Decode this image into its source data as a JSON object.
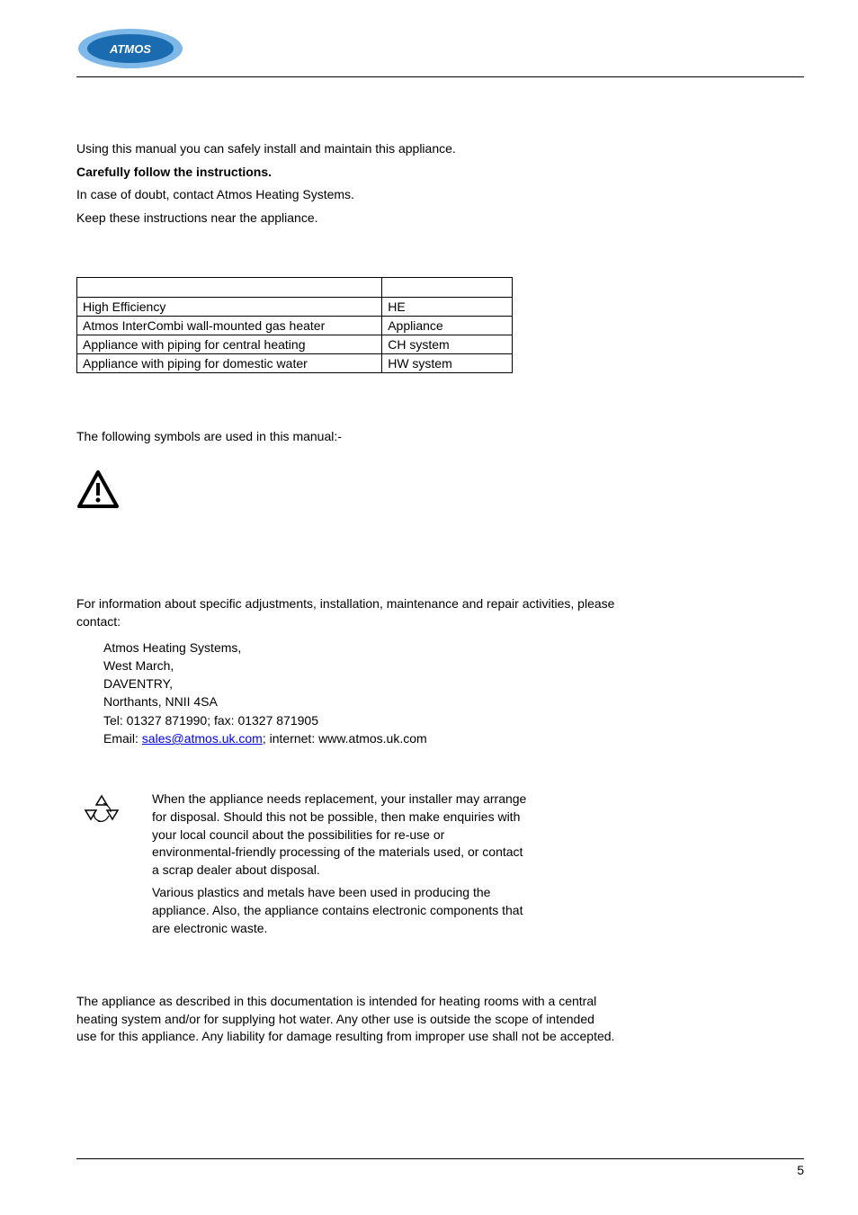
{
  "logo": {
    "text": "ATMOS"
  },
  "intro": {
    "line1a": "Using this manual you can safely install and maintain this appliance.",
    "line1b": "Carefully follow the instructions.",
    "line2": "In case of doubt, contact Atmos Heating Systems.",
    "line3": "Keep these instructions near the appliance."
  },
  "abbrev_table": {
    "rows": [
      {
        "term": "High Efficiency",
        "abbrev": "HE"
      },
      {
        "term": "Atmos InterCombi wall-mounted gas heater",
        "abbrev": "Appliance"
      },
      {
        "term": "Appliance with piping for central heating",
        "abbrev": "CH system"
      },
      {
        "term": "Appliance with piping for domestic water",
        "abbrev": "HW system"
      }
    ]
  },
  "symbols_line": "The following symbols are used in this manual:-",
  "service": {
    "intro": "For information about specific adjustments, installation, maintenance and repair activities, please contact:",
    "address": {
      "name": "Atmos Heating Systems,",
      "street": "West March,",
      "town": "DAVENTRY,",
      "county": "Northants, NNII 4SA",
      "tel": "Tel: 01327 871990; fax: 01327 871905",
      "email_label": "Email: ",
      "email": "sales@atmos.uk.com",
      "internet": "; internet: www.atmos.uk.com"
    }
  },
  "eol": {
    "p1": "When the appliance needs replacement, your installer may arrange for disposal. Should this not be possible, then make enquiries with your local council about the possibilities for re-use or environmental-friendly processing of the materials used, or contact a scrap dealer about disposal.",
    "p2": "Various plastics and metals have been used in producing the appliance. Also, the appliance contains electronic components that are electronic waste."
  },
  "scope": "The appliance as described in this documentation is intended for heating rooms with a central heating system and/or for supplying hot water. Any other use is outside the scope of intended use for this appliance. Any liability for damage resulting from improper use shall not be accepted.",
  "page_number": "5"
}
